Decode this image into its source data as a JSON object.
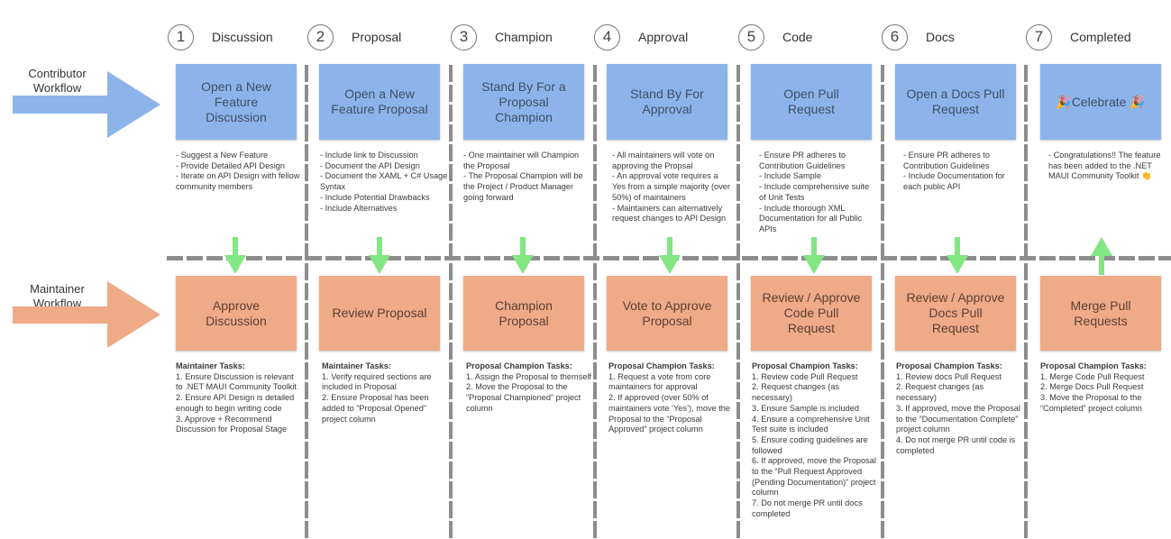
{
  "lanes": {
    "contributor": {
      "label": "Contributor\nWorkflow",
      "arrow_color": "#8db4ea"
    },
    "maintainer": {
      "label": "Maintainer\nWorkflow",
      "arrow_color": "#efaa88"
    }
  },
  "colors": {
    "contributor_box": "#8db4ea",
    "maintainer_box": "#efaa88",
    "transition_arrow": "#82e682",
    "separator": "#8d8d8d"
  },
  "stages": [
    {
      "number": "1",
      "title": "Discussion",
      "contributor_action": "Open a New Feature Discussion",
      "contributor_notes": "- Suggest a New Feature\n- Provide Detailed API Design\n- Iterate on API Design with fellow community members",
      "maintainer_action": "Approve Discussion",
      "maintainer_tasks_heading": "Maintainer Tasks:",
      "maintainer_tasks": "1. Ensure Discussion is relevant to .NET MAUI Community Toolkit\n2. Ensure API Design is detailed enough to begin writing code\n3. Approve + Recommend Discussion for Proposal Stage",
      "transition": "down"
    },
    {
      "number": "2",
      "title": "Proposal",
      "contributor_action": "Open a New Feature Proposal",
      "contributor_notes": "- Include link to Discussion\n- Document the API Design\n- Document the XAML + C# Usage Syntax\n- Include Potential Drawbacks\n- Include Alternatives",
      "maintainer_action": "Review Proposal",
      "maintainer_tasks_heading": "Maintainer Tasks:",
      "maintainer_tasks": "1. Verify required sections are included in Proposal\n2. Ensure Proposal has been added to “Proposal Opened” project column",
      "transition": "down"
    },
    {
      "number": "3",
      "title": "Champion",
      "contributor_action": "Stand By For a Proposal Champion",
      "contributor_notes": "- One maintainer will Champion the Proposal\n- The Proposal Champion will be the Project / Product Manager going forward",
      "maintainer_action": "Champion Proposal",
      "maintainer_tasks_heading": "Proposal Champion Tasks:",
      "maintainer_tasks": "1. Assign the Proposal to themself\n2. Move the Proposal to the “Proposal Championed” project column",
      "transition": "down"
    },
    {
      "number": "4",
      "title": "Approval",
      "contributor_action": "Stand By For Approval",
      "contributor_notes": "- All maintainers will vote on approving the Propsal\n- An approval vote requires a Yes from a simple majority (over 50%) of maintainers\n- Maintainers can alternatively request changes to API Design",
      "maintainer_action": "Vote to Approve Proposal",
      "maintainer_tasks_heading": "Proposal Champion Tasks:",
      "maintainer_tasks": "1. Request a vote from core maintainers for approval\n2. If approved (over 50% of maintainers vote ‘Yes’), move the Proposal to the “Proposal Approved” project column",
      "transition": "down"
    },
    {
      "number": "5",
      "title": "Code",
      "contributor_action": "Open Pull Request",
      "contributor_notes": "- Ensure PR adheres to Contribution Guidelines\n- Include Sample\n- Include comprehensive suite of Unit Tests\n- Include thorough XML Documentation for all Public APIs",
      "maintainer_action": "Review / Approve Code Pull Request",
      "maintainer_tasks_heading": "Proposal Champion Tasks:",
      "maintainer_tasks": "1. Review code Pull Request\n2. Request changes (as necessary)\n3. Ensure Sample is included\n4. Ensure a comprehensive Unit Test suite is included\n5. Ensure coding guidelines are followed\n6. If approved, move the Proposal to the “Pull Request Approved (Pending Documentation)” project column\n7. Do not merge PR until docs completed",
      "transition": "down"
    },
    {
      "number": "6",
      "title": "Docs",
      "contributor_action": "Open a Docs Pull Request",
      "contributor_notes": "- Ensure PR adheres to Contribution Guidelines\n- Include Documentation for each public API",
      "maintainer_action": "Review / Approve Docs Pull Request",
      "maintainer_tasks_heading": "Proposal Champion Tasks:",
      "maintainer_tasks": "1. Review docs Pull Request\n2. Request changes (as necessary)\n3. If approved, move the Proposal to the “Documentation Complete” project column\n4. Do not merge PR until code is completed",
      "transition": "down"
    },
    {
      "number": "7",
      "title": "Completed",
      "contributor_action": "🎉Celebrate 🎉",
      "contributor_notes": "- Congratulations!! The feature has been added to the .NET MAUI Community Toolkit 👏",
      "maintainer_action": "Merge Pull Requests",
      "maintainer_tasks_heading": "Proposal Champion Tasks:",
      "maintainer_tasks": "1. Merge Code Pull Request\n2. Merge Docs Pull Request\n3. Move the Proposal to the “Completed” project column",
      "transition": "up"
    }
  ]
}
